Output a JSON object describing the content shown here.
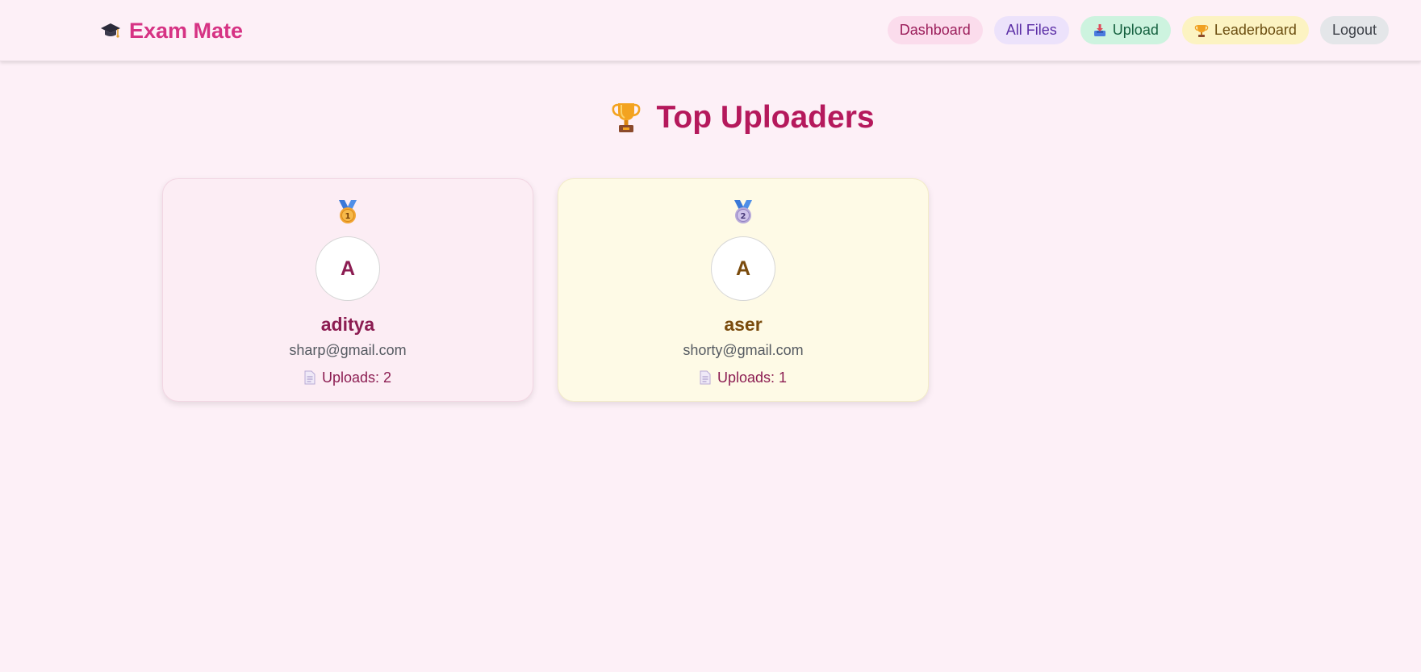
{
  "header": {
    "brand_icon": "graduation-cap-icon",
    "brand_title": "Exam Mate",
    "nav": {
      "dashboard": "Dashboard",
      "all_files": "All Files",
      "upload": "Upload",
      "upload_icon": "inbox-tray-icon",
      "leaderboard": "Leaderboard",
      "leaderboard_icon": "trophy-icon",
      "logout": "Logout"
    }
  },
  "main": {
    "title_icon": "trophy-icon",
    "title": "Top Uploaders",
    "uploaders": [
      {
        "rank_icon": "first-place-medal-icon",
        "rank": "1",
        "initial": "A",
        "name": "aditya",
        "email": "sharp@gmail.com",
        "uploads_icon": "document-icon",
        "uploads_label": "Uploads: 2"
      },
      {
        "rank_icon": "second-place-medal-icon",
        "rank": "2",
        "initial": "A",
        "name": "aser",
        "email": "shorty@gmail.com",
        "uploads_icon": "document-icon",
        "uploads_label": "Uploads: 1"
      }
    ]
  },
  "colors": {
    "background": "#fdf0f7",
    "brand": "#d63384",
    "title": "#b5195c",
    "card_first": "#fcedf4",
    "card_second": "#fefae6"
  }
}
